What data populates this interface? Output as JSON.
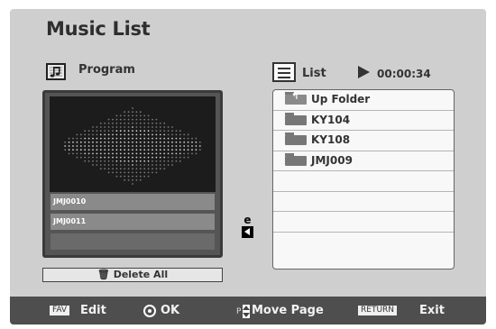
{
  "screen": {
    "title": "Music List"
  },
  "program": {
    "label": "Program",
    "icon": "music-note-icon"
  },
  "list": {
    "label": "List",
    "time": "00:00:34"
  },
  "playlist": {
    "items": [
      "JMJ0010",
      "JMJ0011",
      ""
    ]
  },
  "delete_all": {
    "label": "Delete All"
  },
  "nav": {
    "page_indicator": "e"
  },
  "file_list": {
    "items": [
      {
        "label": "Up Folder",
        "icon": "up-folder-icon"
      },
      {
        "label": "KY104",
        "icon": "folder-icon"
      },
      {
        "label": "KY108",
        "icon": "folder-icon"
      },
      {
        "label": "JMJ009",
        "icon": "folder-icon"
      },
      {
        "label": "",
        "icon": ""
      },
      {
        "label": "",
        "icon": ""
      },
      {
        "label": "",
        "icon": ""
      },
      {
        "label": "",
        "icon": ""
      }
    ]
  },
  "bottom_bar": {
    "fav_key": "FAV",
    "edit": "Edit",
    "ok": "OK",
    "p_key": "P",
    "move_page": "Move Page",
    "return_key": "RETURN",
    "exit": "Exit"
  }
}
